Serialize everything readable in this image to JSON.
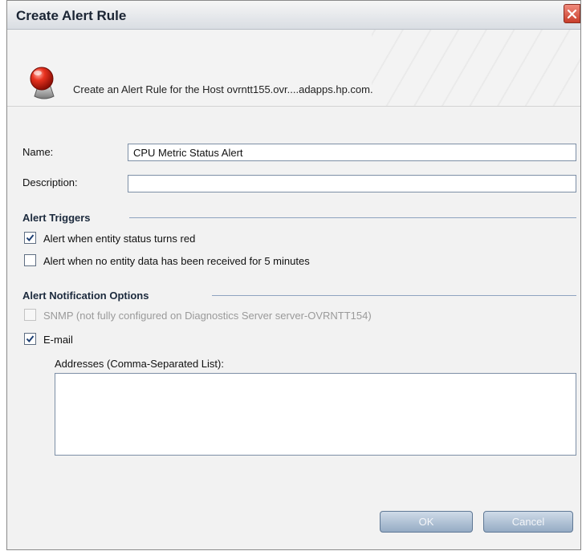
{
  "dialog": {
    "title": "Create Alert Rule",
    "close_icon": "close-icon"
  },
  "header": {
    "icon": "red-alert-icon",
    "message": "Create an Alert Rule for the Host ovrntt155.ovr....adapps.hp.com."
  },
  "form": {
    "name_label": "Name:",
    "name_value": "CPU Metric Status Alert",
    "description_label": "Description:",
    "description_value": ""
  },
  "triggers": {
    "title": "Alert Triggers",
    "options": [
      {
        "label": "Alert when entity status turns red",
        "checked": true
      },
      {
        "label": "Alert when no entity data has been received for 5 minutes",
        "checked": false
      }
    ]
  },
  "notifications": {
    "title": "Alert Notification Options",
    "snmp": {
      "label": "SNMP (not fully configured on Diagnostics Server server-OVRNTT154)",
      "checked": false,
      "disabled": true
    },
    "email": {
      "label": "E-mail",
      "checked": true
    },
    "addresses_label": "Addresses (Comma-Separated List):",
    "addresses_value": ""
  },
  "buttons": {
    "ok": "OK",
    "cancel": "Cancel"
  }
}
